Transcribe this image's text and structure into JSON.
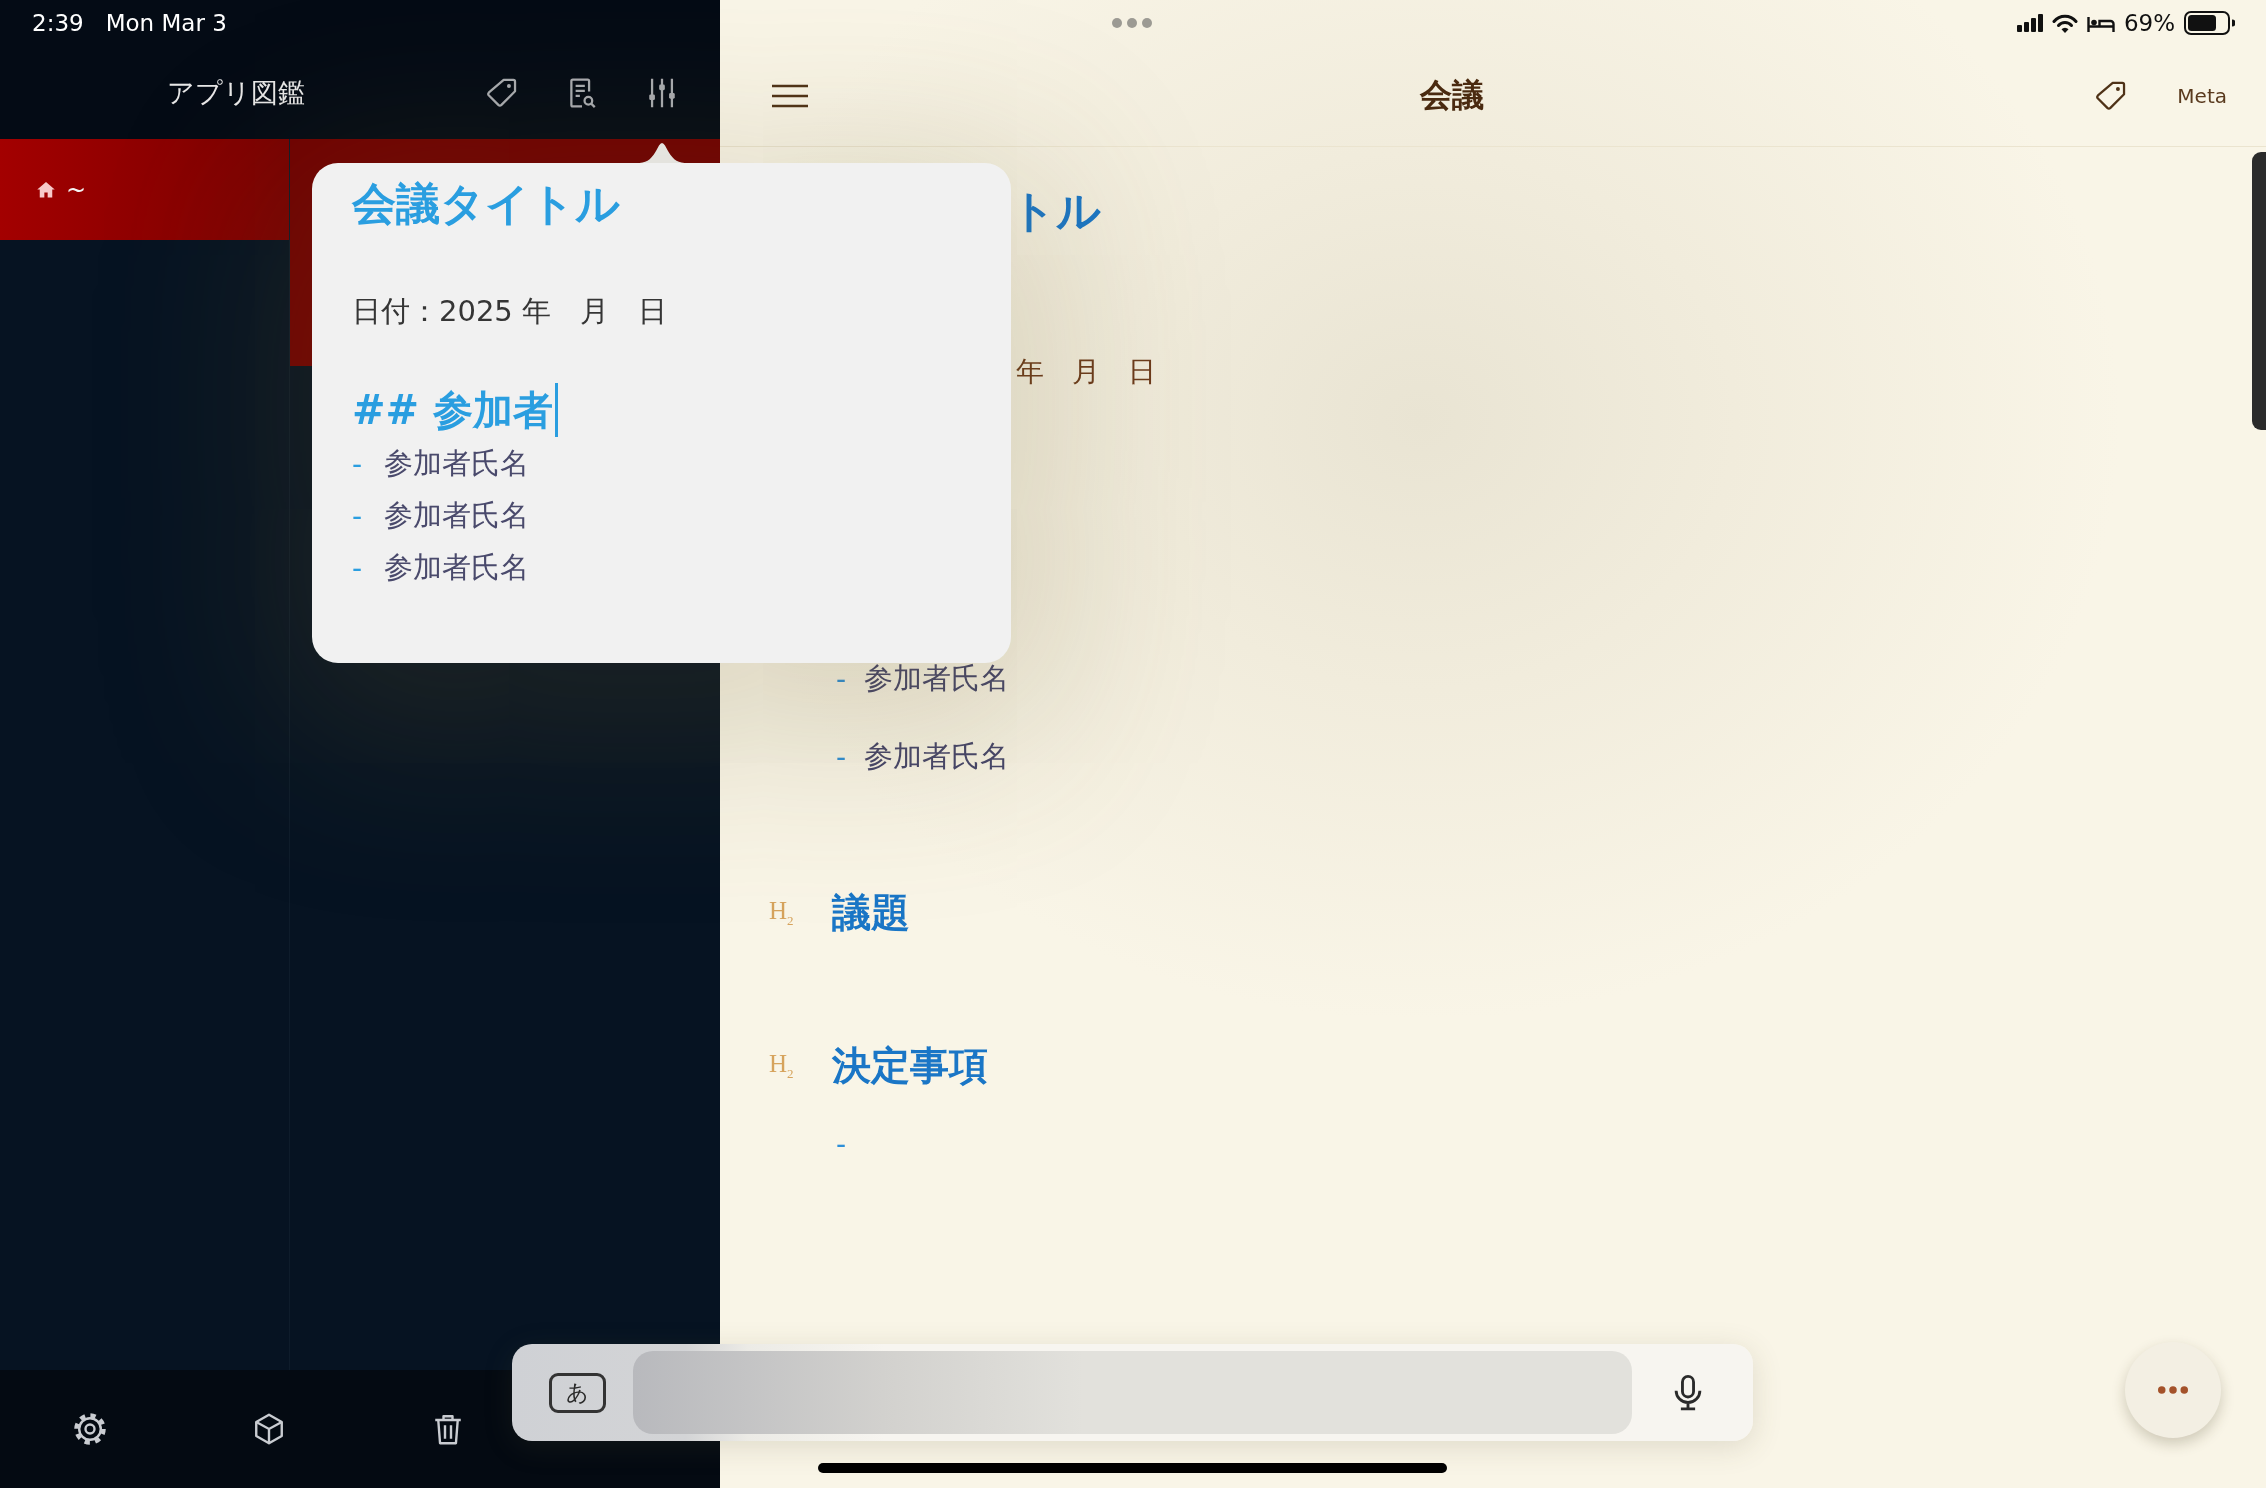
{
  "status_bar": {
    "time": "2:39",
    "date": "Mon Mar 3",
    "battery": "69%"
  },
  "sidebar": {
    "title": "アプリ図鑑",
    "folders": [
      {
        "label": "~",
        "selected": true
      }
    ],
    "notes": [
      {
        "selected": true
      }
    ]
  },
  "editor": {
    "title": "会議",
    "meta_button": "Meta",
    "lines": [
      {
        "kind": "title",
        "text": "トル"
      },
      {
        "kind": "date",
        "text": "年　月　日"
      },
      {
        "kind": "list_item",
        "marker": "-",
        "text": "参加者氏名"
      },
      {
        "kind": "list_item",
        "marker": "-",
        "text": "参加者氏名"
      },
      {
        "kind": "heading",
        "gutter": "H$_{2}$",
        "text": "議題"
      },
      {
        "kind": "heading",
        "gutter": "H$_{2}$",
        "text": "決定事項"
      },
      {
        "kind": "list_item",
        "marker": "-"
      }
    ]
  },
  "popover": {
    "lines": [
      {
        "kind": "title",
        "text": "会議タイトル",
        "cursor": false
      },
      {
        "kind": "paragraph",
        "text": "日付：2025 年　月　日",
        "cursor": false
      },
      {
        "kind": "heading",
        "text": "## 参加者",
        "cursor": true
      },
      {
        "kind": "list_item",
        "marker": "-",
        "text": "参加者氏名",
        "cursor": false
      },
      {
        "kind": "list_item",
        "marker": "-",
        "text": "参加者氏名",
        "cursor": false
      },
      {
        "kind": "list_item",
        "marker": "-",
        "text": "参加者氏名",
        "cursor": false
      }
    ]
  },
  "input_bar": {
    "keyboard_key": "あ"
  }
}
